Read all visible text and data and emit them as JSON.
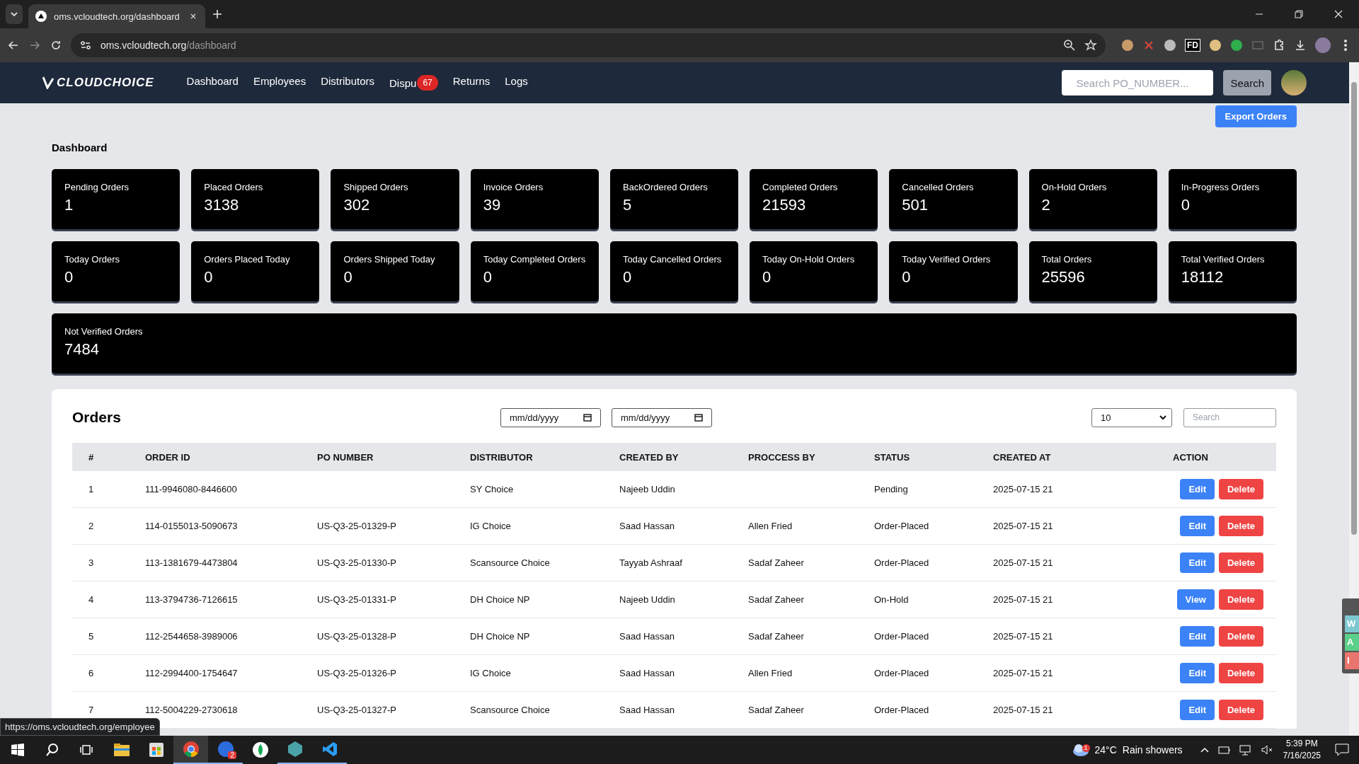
{
  "browser": {
    "tab_title": "oms.vcloudtech.org/dashboard",
    "url_host": "oms.vcloudtech.org",
    "url_path": "/dashboard",
    "status_url": "https://oms.vcloudtech.org/employee",
    "extension_label": "FD"
  },
  "nav": {
    "logo": "CLOUDCHOICE",
    "links": [
      {
        "label": "Dashboard"
      },
      {
        "label": "Employees"
      },
      {
        "label": "Distributors"
      },
      {
        "label": "Dispu",
        "badge": "67"
      },
      {
        "label": "Returns"
      },
      {
        "label": "Logs"
      }
    ],
    "search_placeholder": "Search PO_NUMBER...",
    "search_button": "Search"
  },
  "export_button": "Export Orders",
  "heading": "Dashboard",
  "stats": [
    {
      "label": "Pending Orders",
      "value": "1"
    },
    {
      "label": "Placed Orders",
      "value": "3138"
    },
    {
      "label": "Shipped Orders",
      "value": "302"
    },
    {
      "label": "Invoice Orders",
      "value": "39"
    },
    {
      "label": "BackOrdered Orders",
      "value": "5"
    },
    {
      "label": "Completed Orders",
      "value": "21593"
    },
    {
      "label": "Cancelled Orders",
      "value": "501"
    },
    {
      "label": "On-Hold Orders",
      "value": "2"
    },
    {
      "label": "In-Progress Orders",
      "value": "0"
    },
    {
      "label": "Today Orders",
      "value": "0"
    },
    {
      "label": "Orders Placed Today",
      "value": "0"
    },
    {
      "label": "Orders Shipped Today",
      "value": "0"
    },
    {
      "label": "Today Completed Orders",
      "value": "0"
    },
    {
      "label": "Today Cancelled Orders",
      "value": "0"
    },
    {
      "label": "Today On-Hold Orders",
      "value": "0"
    },
    {
      "label": "Today Verified Orders",
      "value": "0"
    },
    {
      "label": "Total Orders",
      "value": "25596"
    },
    {
      "label": "Total Verified Orders",
      "value": "18112"
    },
    {
      "label": "Not Verified Orders",
      "value": "7484"
    }
  ],
  "orders": {
    "title": "Orders",
    "date_placeholders": [
      "mm/dd/yyyy",
      "mm/dd/yyyy"
    ],
    "page_size": "10",
    "search_placeholder": "Search",
    "columns": [
      "#",
      "ORDER ID",
      "PO NUMBER",
      "DISTRIBUTOR",
      "CREATED BY",
      "PROCCESS BY",
      "STATUS",
      "CREATED AT",
      "ACTION"
    ],
    "rows": [
      {
        "cells": [
          "1",
          "111-9946080-8446600",
          "",
          "SY Choice",
          "Najeeb Uddin",
          "",
          "Pending",
          "2025-07-15 21"
        ],
        "actions": [
          {
            "label": "Edit",
            "kind": "primary"
          },
          {
            "label": "Delete",
            "kind": "danger"
          }
        ]
      },
      {
        "cells": [
          "2",
          "114-0155013-5090673",
          "US-Q3-25-01329-P",
          "IG Choice",
          "Saad Hassan",
          "Allen Fried",
          "Order-Placed",
          "2025-07-15 21"
        ],
        "actions": [
          {
            "label": "Edit",
            "kind": "primary"
          },
          {
            "label": "Delete",
            "kind": "danger"
          }
        ]
      },
      {
        "cells": [
          "3",
          "113-1381679-4473804",
          "US-Q3-25-01330-P",
          "Scansource Choice",
          "Tayyab Ashraaf",
          "Sadaf Zaheer",
          "Order-Placed",
          "2025-07-15 21"
        ],
        "actions": [
          {
            "label": "Edit",
            "kind": "primary"
          },
          {
            "label": "Delete",
            "kind": "danger"
          }
        ]
      },
      {
        "cells": [
          "4",
          "113-3794736-7126615",
          "US-Q3-25-01331-P",
          "DH Choice NP",
          "Najeeb Uddin",
          "Sadaf Zaheer",
          "On-Hold",
          "2025-07-15 21"
        ],
        "actions": [
          {
            "label": "View",
            "kind": "primary"
          },
          {
            "label": "Delete",
            "kind": "danger"
          }
        ]
      },
      {
        "cells": [
          "5",
          "112-2544658-3989006",
          "US-Q3-25-01328-P",
          "DH Choice NP",
          "Saad Hassan",
          "Sadaf Zaheer",
          "Order-Placed",
          "2025-07-15 21"
        ],
        "actions": [
          {
            "label": "Edit",
            "kind": "primary"
          },
          {
            "label": "Delete",
            "kind": "danger"
          }
        ]
      },
      {
        "cells": [
          "6",
          "112-2994400-1754647",
          "US-Q3-25-01326-P",
          "IG Choice",
          "Saad Hassan",
          "Allen Fried",
          "Order-Placed",
          "2025-07-15 21"
        ],
        "actions": [
          {
            "label": "Edit",
            "kind": "primary"
          },
          {
            "label": "Delete",
            "kind": "danger"
          }
        ]
      },
      {
        "cells": [
          "7",
          "112-5004229-2730618",
          "US-Q3-25-01327-P",
          "Scansource Choice",
          "Saad Hassan",
          "Sadaf Zaheer",
          "Order-Placed",
          "2025-07-15 21"
        ],
        "actions": [
          {
            "label": "Edit",
            "kind": "primary"
          },
          {
            "label": "Delete",
            "kind": "danger"
          }
        ]
      }
    ]
  },
  "side_tabs": [
    {
      "label": "W",
      "color": "#7ec8d0"
    },
    {
      "label": "A",
      "color": "#5ccf8a"
    },
    {
      "label": "I",
      "color": "#e8766e"
    }
  ],
  "taskbar": {
    "zoom_badge": "2",
    "weather_badge": "1",
    "temperature": "24°C",
    "weather": "Rain showers",
    "time": "5:39 PM",
    "date": "7/16/2025"
  }
}
